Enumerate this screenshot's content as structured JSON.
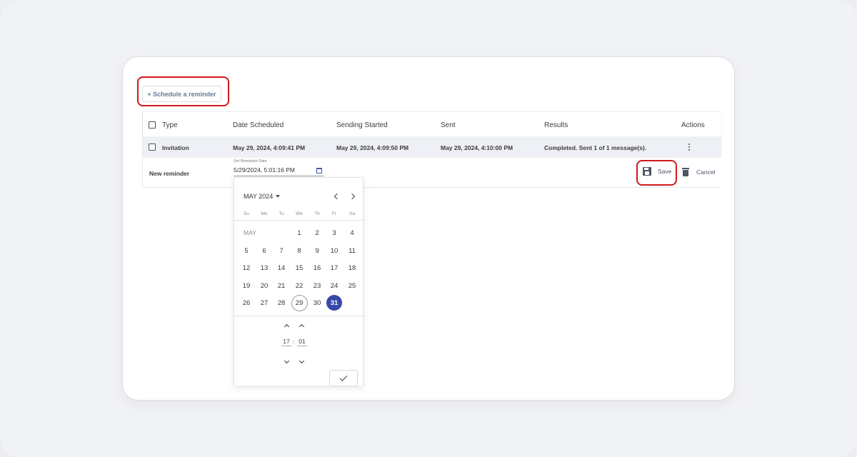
{
  "schedule_button": {
    "label": "+ Schedule a reminder"
  },
  "table": {
    "headers": {
      "type": "Type",
      "date_scheduled": "Date Scheduled",
      "sending_started": "Sending Started",
      "sent": "Sent",
      "results": "Results",
      "actions": "Actions"
    },
    "rows": [
      {
        "type": "Invitation",
        "date_scheduled": "May 29, 2024, 4:09:41 PM",
        "sending_started": "May 29, 2024, 4:09:50 PM",
        "sent": "May 29, 2024, 4:10:00 PM",
        "results": "Completed. Sent 1 of 1 message(s)."
      }
    ]
  },
  "new_reminder": {
    "label": "New reminder",
    "field_caption": "Set Reminder Date",
    "field_value": "5/29/2024, 5:01:16 PM",
    "save_label": "Save",
    "cancel_label": "Cancel"
  },
  "date_picker": {
    "month_label": "MAY 2024",
    "weekday_headers": [
      "Su",
      "Mo",
      "Tu",
      "We",
      "Th",
      "Fr",
      "Sa"
    ],
    "month_short": "MAY",
    "days": [
      "1",
      "2",
      "3",
      "4",
      "5",
      "6",
      "7",
      "8",
      "9",
      "10",
      "11",
      "12",
      "13",
      "14",
      "15",
      "16",
      "17",
      "18",
      "19",
      "20",
      "21",
      "22",
      "23",
      "24",
      "25",
      "26",
      "27",
      "28",
      "29",
      "30",
      "31"
    ],
    "today": "29",
    "selected": "31",
    "hour": "17",
    "minute": "01",
    "time_separator": ":"
  },
  "colors": {
    "highlight": "#d0191e",
    "selected_day": "#3848a8",
    "calendar_icon": "#3d56b6"
  }
}
